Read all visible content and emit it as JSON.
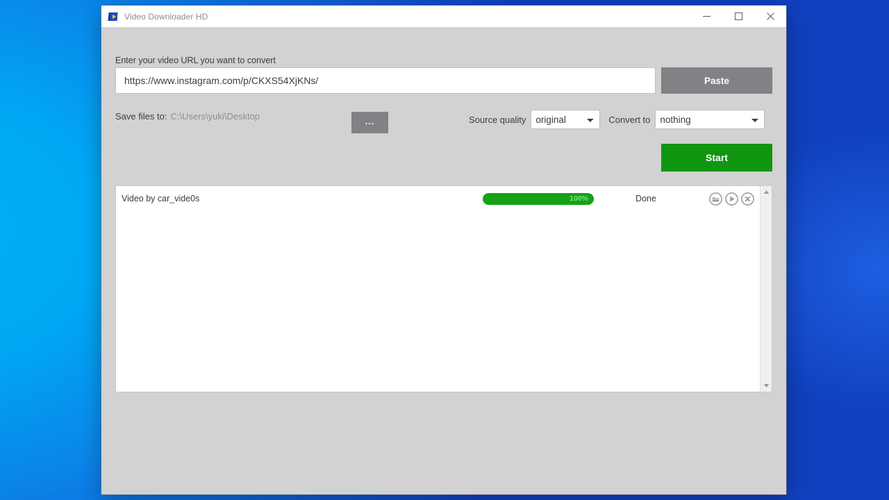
{
  "window": {
    "title": "Video Downloader HD",
    "icon": "app-video-icon",
    "controls": {
      "minimize": "minimize-icon",
      "maximize": "maximize-icon",
      "close": "close-icon"
    }
  },
  "form": {
    "url_label": "Enter your video URL you want to convert",
    "url_value": "https://www.instagram.com/p/CKXS54XjKNs/",
    "url_placeholder": "Enter your video URL you want to convert",
    "paste_label": "Paste",
    "save_label": "Save files to:",
    "save_path": "C:\\Users\\yuki\\Desktop",
    "browse_label": "...",
    "source_quality_label": "Source quality",
    "source_quality_value": "original",
    "source_quality_options": [
      "original"
    ],
    "convert_to_label": "Convert to",
    "convert_to_value": "nothing",
    "convert_to_options": [
      "nothing"
    ],
    "start_label": "Start"
  },
  "downloads": {
    "rows": [
      {
        "title": "Video by car_vide0s",
        "progress_text": "100%",
        "progress_percent": 100,
        "status": "Done",
        "actions": [
          "folder-icon",
          "play-icon",
          "remove-icon"
        ]
      }
    ]
  },
  "scrollbar": {
    "up": "scroll-up-arrow-icon",
    "down": "scroll-down-arrow-icon"
  },
  "colors": {
    "accent_green": "#119611",
    "progress_green": "#15a215",
    "button_gray": "#808285",
    "window_gray": "#d2d2d2",
    "desktop_blue": "#00a8f4"
  }
}
